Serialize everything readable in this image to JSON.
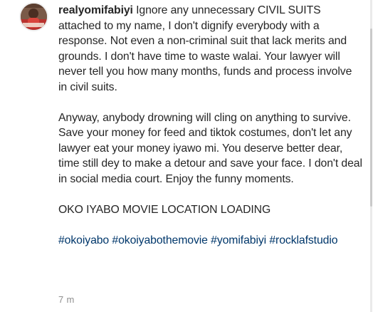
{
  "post": {
    "username": "realyomifabiyi",
    "avatar_icon": "profile-avatar",
    "paragraph1": " Ignore any unnecessary CIVIL SUITS attached to my name, I don't dignify everybody with a response. Not even a non-criminal suit that lack merits and grounds. I don't have time to waste walai. Your lawyer will never tell you how many months, funds and process involve in civil suits.",
    "paragraph2": "Anyway, anybody drowning will cling on anything to survive. Save your money for feed and tiktok costumes, don't let any lawyer eat your money iyawo mi. You deserve better dear, time still dey to make a detour and save your face. I don't deal in social media court. Enjoy the funny moments.",
    "paragraph3": "OKO IYABO MOVIE LOCATION LOADING",
    "hashtags": [
      "#okoiyabo",
      "#okoiyabothemovie",
      "#yomifabiyi",
      "#rocklafstudio"
    ],
    "timestamp": "7 m"
  },
  "colors": {
    "text": "#262626",
    "hashtag": "#00376b",
    "meta": "#8e8e8e"
  }
}
